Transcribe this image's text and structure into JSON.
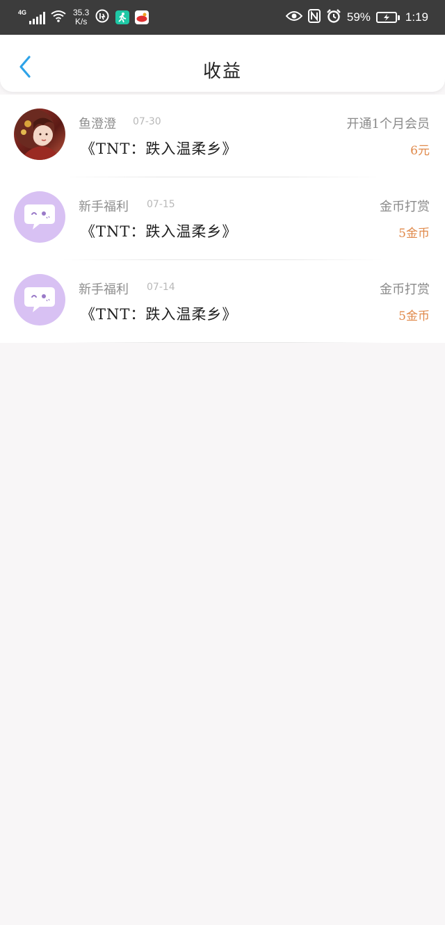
{
  "status_bar": {
    "network": "4G",
    "speed_value": "35.3",
    "speed_unit": "K/s",
    "battery_percent": "59%",
    "time": "1:19"
  },
  "header": {
    "title": "收益"
  },
  "records": [
    {
      "name": "鱼澄澄",
      "date": "07-30",
      "book": "《TNT：跌入温柔乡》",
      "type": "开通1个月会员",
      "amount": "6元",
      "avatar": "user-photo"
    },
    {
      "name": "新手福利",
      "date": "07-15",
      "book": "《TNT：跌入温柔乡》",
      "type": "金币打赏",
      "amount": "5金币",
      "avatar": "chat-bubble-icon"
    },
    {
      "name": "新手福利",
      "date": "07-14",
      "book": "《TNT：跌入温柔乡》",
      "type": "金币打赏",
      "amount": "5金币",
      "avatar": "chat-bubble-icon"
    }
  ],
  "colors": {
    "accent_blue": "#2ea3e8",
    "amount_orange": "#e0894a",
    "avatar_purple": "#d8c1f3"
  }
}
